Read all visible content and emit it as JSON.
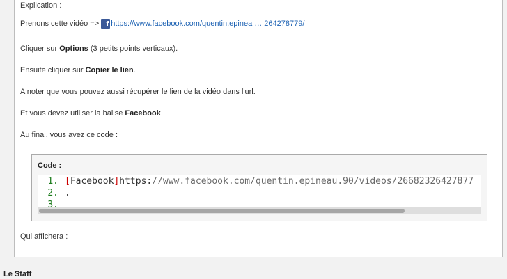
{
  "post": {
    "explication": "Explication :",
    "prenons_prefix": "Prenons cette vidéo => ",
    "fb_link": "https://www.facebook.com/quentin.epinea … 264278779/",
    "cliquer_prefix": "Cliquer sur ",
    "cliquer_bold": "Options",
    "cliquer_suffix": " (3 petits points verticaux).",
    "ensuite_prefix": "Ensuite cliquer sur ",
    "ensuite_bold": "Copier le lien",
    "ensuite_suffix": ".",
    "noter": "A noter que vous pouvez aussi récupérer le lien de la vidéo dans l'url.",
    "devez_prefix": "Et vous devez utiliser la balise ",
    "devez_bold": "Facebook",
    "final": "Au final, vous avez ce code :",
    "affichera": "Qui affichera :"
  },
  "code_block": {
    "title": "Code :",
    "lines": [
      {
        "num": "1.",
        "bracket_open": "[",
        "tag": "Facebook",
        "bracket_close": "]",
        "url_start": "https:",
        "url_rest": "//www.facebook.com/quentin.epineau.90/videos/26682326427877"
      },
      {
        "num": "2.",
        "text": "."
      },
      {
        "num": "3.",
        "text": ""
      }
    ],
    "scroll_fraction": 0.83
  },
  "footer": {
    "staff": "Le Staff"
  },
  "colors": {
    "link": "#1d62b3",
    "facebook_brand": "#3b5998",
    "line_number": "#1a7a1a",
    "bracket": "#cc0000"
  },
  "icons": {
    "facebook": "facebook-icon"
  }
}
